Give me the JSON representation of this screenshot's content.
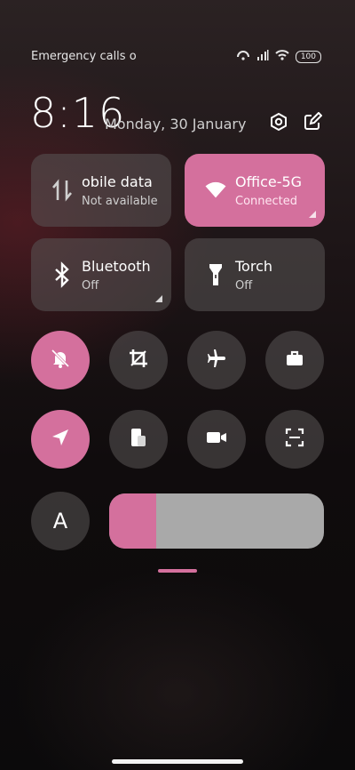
{
  "status_bar": {
    "left_text": "Emergency calls o",
    "battery": "100",
    "icons": [
      "hotspot-icon",
      "signal-icon",
      "wifi-icon",
      "battery-icon"
    ]
  },
  "header": {
    "time": "8:16",
    "date": "Monday, 30 January",
    "icons": [
      "settings-icon",
      "edit-icon"
    ]
  },
  "tiles": [
    {
      "title": "obile data",
      "subtitle": "Not available",
      "icon": "mobile-data-icon",
      "active": false
    },
    {
      "title": "Office-5G",
      "subtitle": "Connected",
      "icon": "wifi-icon",
      "active": true
    },
    {
      "title": "Bluetooth",
      "subtitle": "Off",
      "icon": "bluetooth-icon",
      "active": false
    },
    {
      "title": "Torch",
      "subtitle": "Off",
      "icon": "torch-icon",
      "active": false
    }
  ],
  "toggles_row1": [
    {
      "name": "mute-icon",
      "active": true
    },
    {
      "name": "crop-icon",
      "active": false
    },
    {
      "name": "airplane-icon",
      "active": false
    },
    {
      "name": "work-icon",
      "active": false
    }
  ],
  "toggles_row2": [
    {
      "name": "location-icon",
      "active": true
    },
    {
      "name": "screen-icon",
      "active": false
    },
    {
      "name": "video-icon",
      "active": false
    },
    {
      "name": "scan-icon",
      "active": false
    }
  ],
  "auto_brightness_label": "A",
  "brightness": {
    "level": 0.22
  },
  "colors": {
    "accent": "#d4709d",
    "tile": "#5a5556",
    "slider_track": "#a9a9a9"
  }
}
